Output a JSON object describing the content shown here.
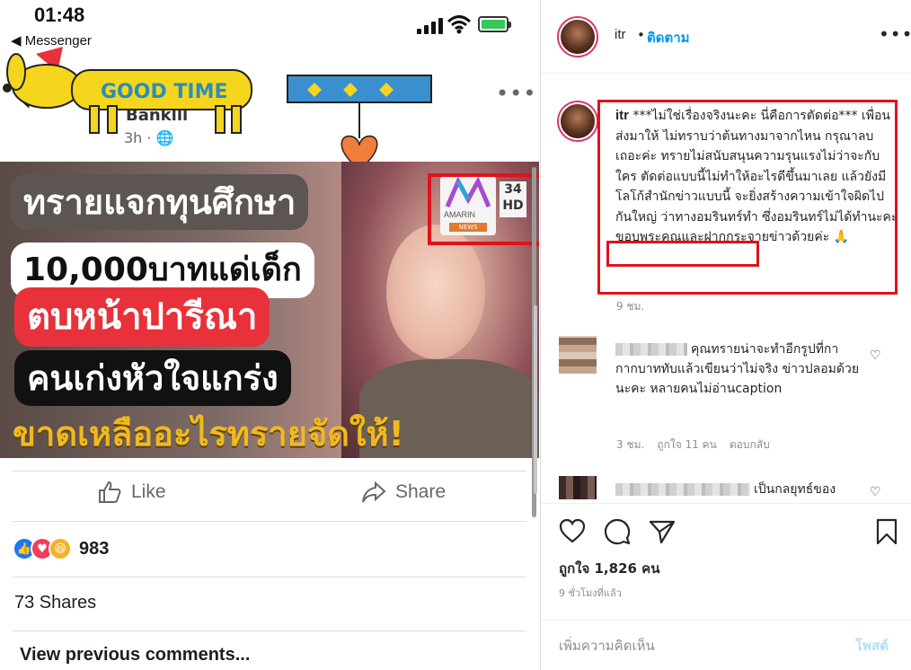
{
  "facebook": {
    "status_time": "01:48",
    "back_app": "◀ Messenger",
    "page_name": "Banklll",
    "post_time": "3h · ",
    "sticker_text": "GOOD TIME",
    "news_lines": [
      "ทรายแจกทุนศึกษา",
      "10,000บาทแด่เด็ก",
      "ตบหน้าปารีณา",
      "คนเก่งหัวใจแกร่ง",
      "ขาดเหลืออะไรทรายจัดให้!"
    ],
    "channel_brand": "AMARIN",
    "channel_news_tag": "NEWS",
    "channel_number": "34",
    "channel_hd": "HD",
    "like_label": "Like",
    "share_label": "Share",
    "reaction_count": "983",
    "shares_label": "73 Shares",
    "view_previous": "View previous comments..."
  },
  "instagram": {
    "username": "itr",
    "dot": "•",
    "follow_label": "ติดตาม",
    "caption_user": "itr",
    "caption_before": " ***ไม่ใช่เรื่องจริงนะคะ นี่คือการตัดต่อ*** เพื่อนส่งมาให้ ไม่ทราบว่าต้นทางมาจากไหน กรุณาลบเถอะค่ะ ทรายไม่สนับสนุนความรุนแรงไม่ว่าจะกับใคร ตัดต่อแบบนี้ไม่ทำให้อะไรดีขึ้นมาเลย แล้วยังมีโลโก้สำนักข่าวแบบนี้ จะยิ่งสร้างความเข้าใจผิดไปกันใหญ่ ว่าทางอมรินทร์ทำ ซึ่ง",
    "caption_highlight": "อมรินทร์ไม่ได้ทำนะคะ",
    "caption_after": " ขอบพระคุณและฝากกระจายข่าวด้วยค่ะ 🙏",
    "caption_time": "9 ชม.",
    "comment1_text": "คุณทรายน่าจะทำอีกรูปที่กากากบาททับแล้วเขียนว่าไม่จริง ข่าวปลอมด้วยนะคะ หลายคนไม่อ่านcaption",
    "comment1_time": "3 ชม.",
    "comment1_likes": "ถูกใจ 11 คน",
    "comment1_reply": "ตอบกลับ",
    "comment2_text": "เป็นกลยุทธ์ของ",
    "likes_label": "ถูกใจ 1,826 คน",
    "time_ago": "9 ชั่วโมงที่แล้ว",
    "add_comment_placeholder": "เพิ่มความคิดเห็น",
    "post_label": "โพสต์"
  },
  "colors": {
    "fb_gray": "#65676b",
    "ig_blue": "#0095f6",
    "highlight_red": "#e0121b",
    "news_red": "#e8313a",
    "news_yellow": "#f0b91e"
  }
}
